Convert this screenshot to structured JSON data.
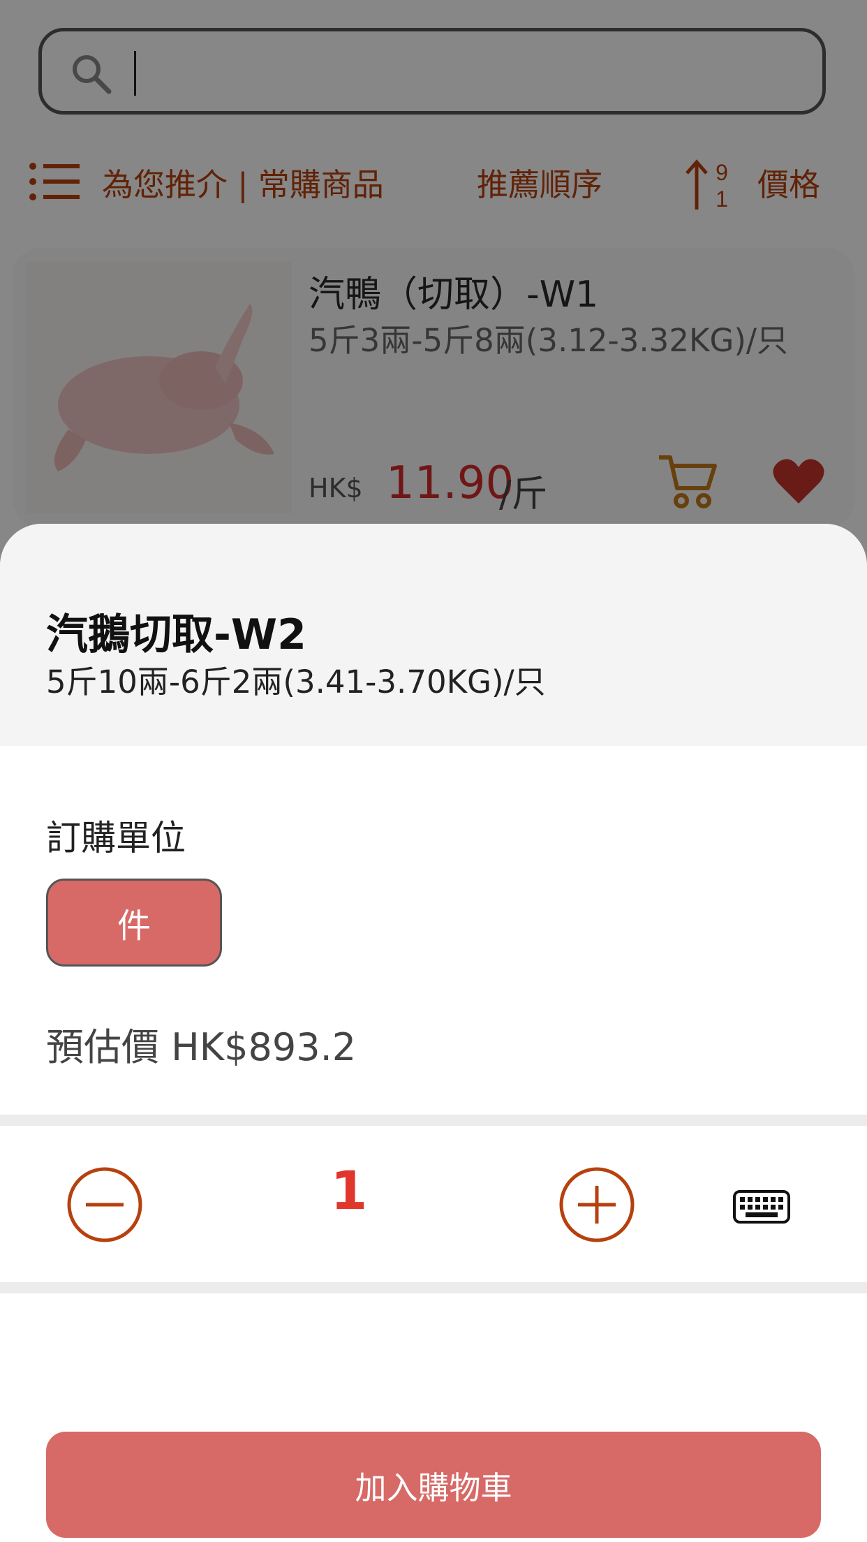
{
  "search": {
    "placeholder": ""
  },
  "filter_bar": {
    "recommend_label": "為您推介 | 常購商品",
    "sort_label": "推薦順序",
    "sort_icon_top": "9",
    "sort_icon_bottom": "1",
    "price_label": "價格"
  },
  "product": {
    "name": "汽鴨（切取）-W1",
    "spec": "5斤3兩-5斤8兩(3.12-3.32KG)/只",
    "currency": "HK$",
    "price": "11.90",
    "unit": "/斤"
  },
  "sheet": {
    "title": "汽鵝切取-W2",
    "spec": "5斤10兩-6斤2兩(3.41-3.70KG)/只",
    "unit_label": "訂購單位",
    "unit_option": "件",
    "estimate": "預估價 HK$893.2",
    "quantity": "1",
    "add_to_cart": "加入購物車"
  },
  "colors": {
    "accent": "#b7410e",
    "button": "#d76a66",
    "price_red": "#d42a2a",
    "qty_red": "#e0362b"
  },
  "icons": [
    "search-icon",
    "list-icon",
    "sort-icon",
    "cart-icon",
    "heart-icon",
    "minus-icon",
    "plus-icon",
    "keyboard-icon"
  ]
}
